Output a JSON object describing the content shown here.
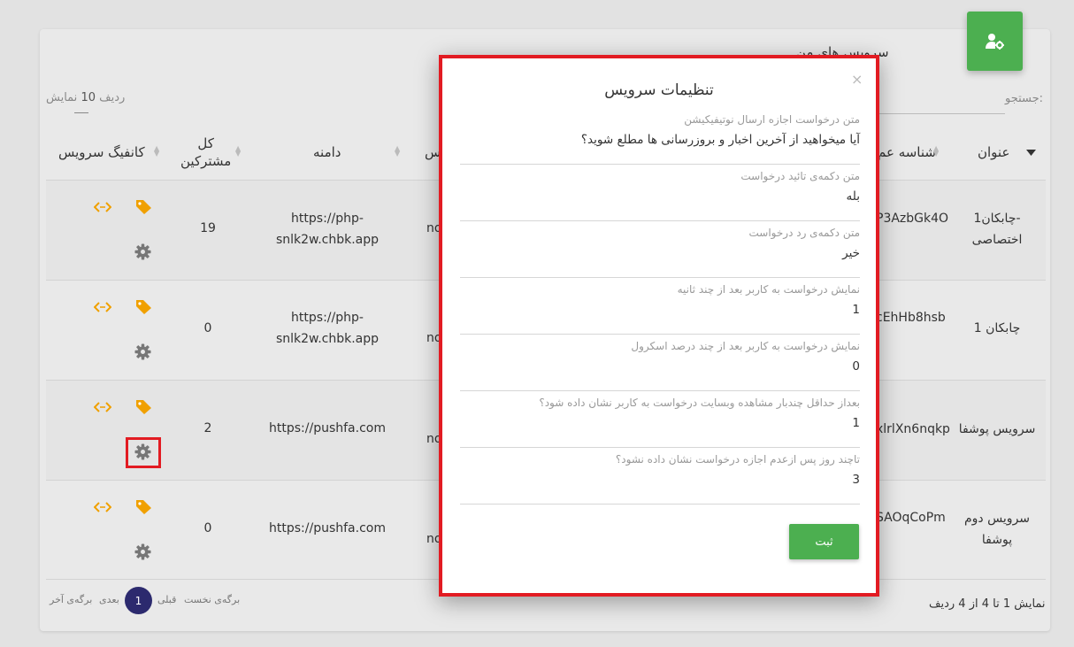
{
  "card": {
    "title": "سرویس های من",
    "search_label": "جستجو:",
    "page_size_prefix": "نمایش",
    "page_size": "10",
    "page_size_suffix": "ردیف"
  },
  "table": {
    "headers": {
      "title": "عنوان",
      "id": "شناسه عم",
      "hidden": "س",
      "domain": "دامنه",
      "total_line1": "کل",
      "total_line2": "مشترکین",
      "config": "کانفیگ سرویس"
    },
    "rows": [
      {
        "title_line1": "چابکان1-",
        "title_line2": "اختصاصی",
        "id": "P3AzbGk4O",
        "partial": "no",
        "domain_line1": "https://php-",
        "domain_line2": "snlk2w.chbk.app",
        "total": "19"
      },
      {
        "title_line1": "چابکان 1",
        "title_line2": "",
        "id": "cEhHb8hsb",
        "partial": "no",
        "domain_line1": "https://php-",
        "domain_line2": "snlk2w.chbk.app",
        "total": "0"
      },
      {
        "title_line1": "سرویس پوشفا",
        "title_line2": "",
        "id": "xlrlXn6nqkp",
        "partial": "no",
        "domain_line1": "https://pushfa.com",
        "domain_line2": "",
        "total": "2"
      },
      {
        "title_line1": "سرویس دوم",
        "title_line2": "پوشفا",
        "id": "SAOqCoPm",
        "partial": "no",
        "domain_line1": "https://pushfa.com",
        "domain_line2": "",
        "total": "0"
      }
    ]
  },
  "footer": {
    "info": "نمایش 1 تا 4 از 4 ردیف",
    "first": "برگه‌ی نخست",
    "prev": "قبلی",
    "current": "1",
    "next": "بعدی",
    "last": "برگه‌ی آخر"
  },
  "modal": {
    "title": "تنظیمات سرویس",
    "close": "×",
    "fields": [
      {
        "label": "متن درخواست اجازه ارسال نوتیفیکیشن",
        "value": "آیا میخواهید از آخرین اخبار و بروزرسانی ها مطلع شوید؟"
      },
      {
        "label": "متن دکمه‌ی تائید درخواست",
        "value": "بله"
      },
      {
        "label": "متن دکمه‌ی رد درخواست",
        "value": "خیر"
      },
      {
        "label": "نمایش درخواست به کاربر بعد از چند ثانیه",
        "value": "1"
      },
      {
        "label": "نمایش درخواست به کاربر بعد از چند درصد اسکرول",
        "value": "0"
      },
      {
        "label": "بعداز حداقل چندبار مشاهده وبسایت درخواست به کاربر نشان داده شود؟",
        "value": "1"
      },
      {
        "label": "تاچند روز پس ازعدم اجازه درخواست نشان داده نشود؟",
        "value": "3"
      }
    ],
    "submit": "ثبت"
  },
  "colors": {
    "accent_green": "#4caf50",
    "icon_orange": "#f0a000",
    "gear_gray": "#777777",
    "highlight_red": "#e21b22",
    "pager_navy": "#2c2a6e"
  },
  "icons": {
    "header": "user-gear-icon",
    "tag": "tag-icon",
    "code": "code-icon",
    "settings": "gear-icon",
    "sort": "sort-arrows-icon",
    "dropdown": "caret-down-icon"
  }
}
